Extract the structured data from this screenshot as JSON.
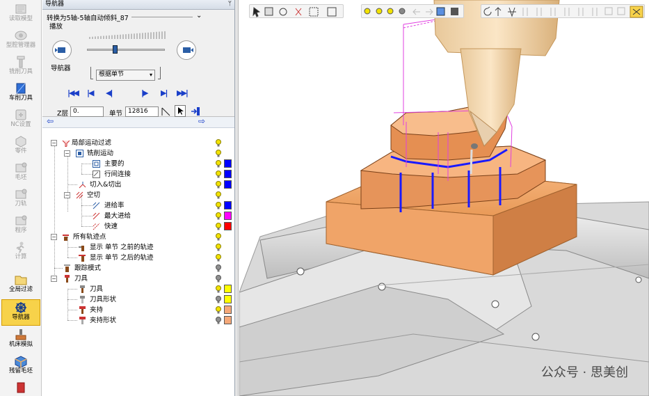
{
  "sidebar": {
    "items": [
      {
        "label": "读取模型",
        "icon": "read-model-icon"
      },
      {
        "label": "型腔管理器",
        "icon": "cavity-manager-icon"
      },
      {
        "label": "铣削刀具",
        "icon": "milling-tool-icon"
      },
      {
        "label": "车削刀具",
        "icon": "turning-tool-icon"
      },
      {
        "label": "NC设置",
        "icon": "nc-settings-icon"
      },
      {
        "label": "零件",
        "icon": "part-icon"
      },
      {
        "label": "毛坯",
        "icon": "stock-icon"
      },
      {
        "label": "刀轨",
        "icon": "toolpath-icon"
      },
      {
        "label": "程序",
        "icon": "program-icon"
      },
      {
        "label": "计算",
        "icon": "calculate-icon"
      },
      {
        "label": "全局过滤",
        "icon": "global-filter-icon"
      },
      {
        "label": "导航器",
        "icon": "navigator-icon"
      },
      {
        "label": "机床模拟",
        "icon": "machine-sim-icon"
      },
      {
        "label": "残留毛坯",
        "icon": "remaining-stock-icon"
      }
    ]
  },
  "panel": {
    "title": "导航器",
    "pin": "ᛘ",
    "program_name": "转换为5轴-5轴自动倾斜_87",
    "play_label": "播放",
    "navigator_label": "导航器",
    "mode_select": "根据单节",
    "z_label": "Z层",
    "z_value": "0.",
    "block_label": "单节",
    "block_value": "12816"
  },
  "tree": {
    "rows": [
      {
        "label": "局部运动过滤",
        "bulb": "#f2e200",
        "swatch": null
      },
      {
        "label": "铣削运动",
        "bulb": "#f2e200",
        "swatch": null
      },
      {
        "label": "主要的",
        "bulb": "#f2e200",
        "swatch": "#0000ff"
      },
      {
        "label": "行间连接",
        "bulb": "#f2e200",
        "swatch": "#0000ff"
      },
      {
        "label": "切入&切出",
        "bulb": "#f2e200",
        "swatch": "#0000ff"
      },
      {
        "label": "空切",
        "bulb": "#f2e200",
        "swatch": null
      },
      {
        "label": "进给率",
        "bulb": "#f2e200",
        "swatch": "#0000ff"
      },
      {
        "label": "最大进给",
        "bulb": "#f2e200",
        "swatch": "#ff00ff"
      },
      {
        "label": "快速",
        "bulb": "#f2e200",
        "swatch": "#ff0000"
      },
      {
        "label": "所有轨迹点",
        "bulb": "#f2e200",
        "swatch": null
      },
      {
        "label": "显示 单节 之前的轨迹",
        "bulb": "#f2e200",
        "swatch": null
      },
      {
        "label": "显示 单节 之后的轨迹",
        "bulb": "#f2e200",
        "swatch": null
      },
      {
        "label": "跟踪模式",
        "bulb": "#909090",
        "swatch": null
      },
      {
        "label": "刀具",
        "bulb": "#909090",
        "swatch": null
      },
      {
        "label": "刀具",
        "bulb": "#f2e200",
        "swatch": "#ffff00"
      },
      {
        "label": "刀具形状",
        "bulb": "#909090",
        "swatch": "#ffff00"
      },
      {
        "label": "夹持",
        "bulb": "#f2e200",
        "swatch": "#f5a878"
      },
      {
        "label": "夹持形状",
        "bulb": "#909090",
        "swatch": "#f5a878"
      }
    ]
  },
  "watermark": "公众号 · 思美创",
  "colors": {
    "accent": "#1a3fc9",
    "active_bg": "#f7d24a",
    "part": "#f0a060"
  }
}
